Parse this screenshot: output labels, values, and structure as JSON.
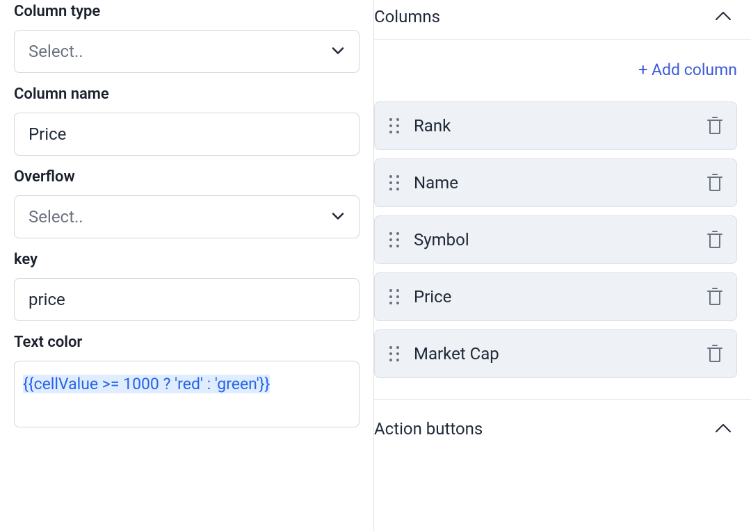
{
  "left": {
    "column_type": {
      "label": "Column type",
      "placeholder": "Select.."
    },
    "column_name": {
      "label": "Column name",
      "value": "Price"
    },
    "overflow": {
      "label": "Overflow",
      "placeholder": "Select.."
    },
    "key": {
      "label": "key",
      "value": "price"
    },
    "text_color": {
      "label": "Text color",
      "value": "{{cellValue >= 1000 ? 'red' : 'green'}}"
    }
  },
  "right": {
    "columns_section": {
      "title": "Columns",
      "add_link": "+ Add column",
      "items": [
        {
          "name": "Rank"
        },
        {
          "name": "Name"
        },
        {
          "name": "Symbol"
        },
        {
          "name": "Price"
        },
        {
          "name": "Market Cap"
        }
      ]
    },
    "actions_section": {
      "title": "Action buttons"
    }
  }
}
